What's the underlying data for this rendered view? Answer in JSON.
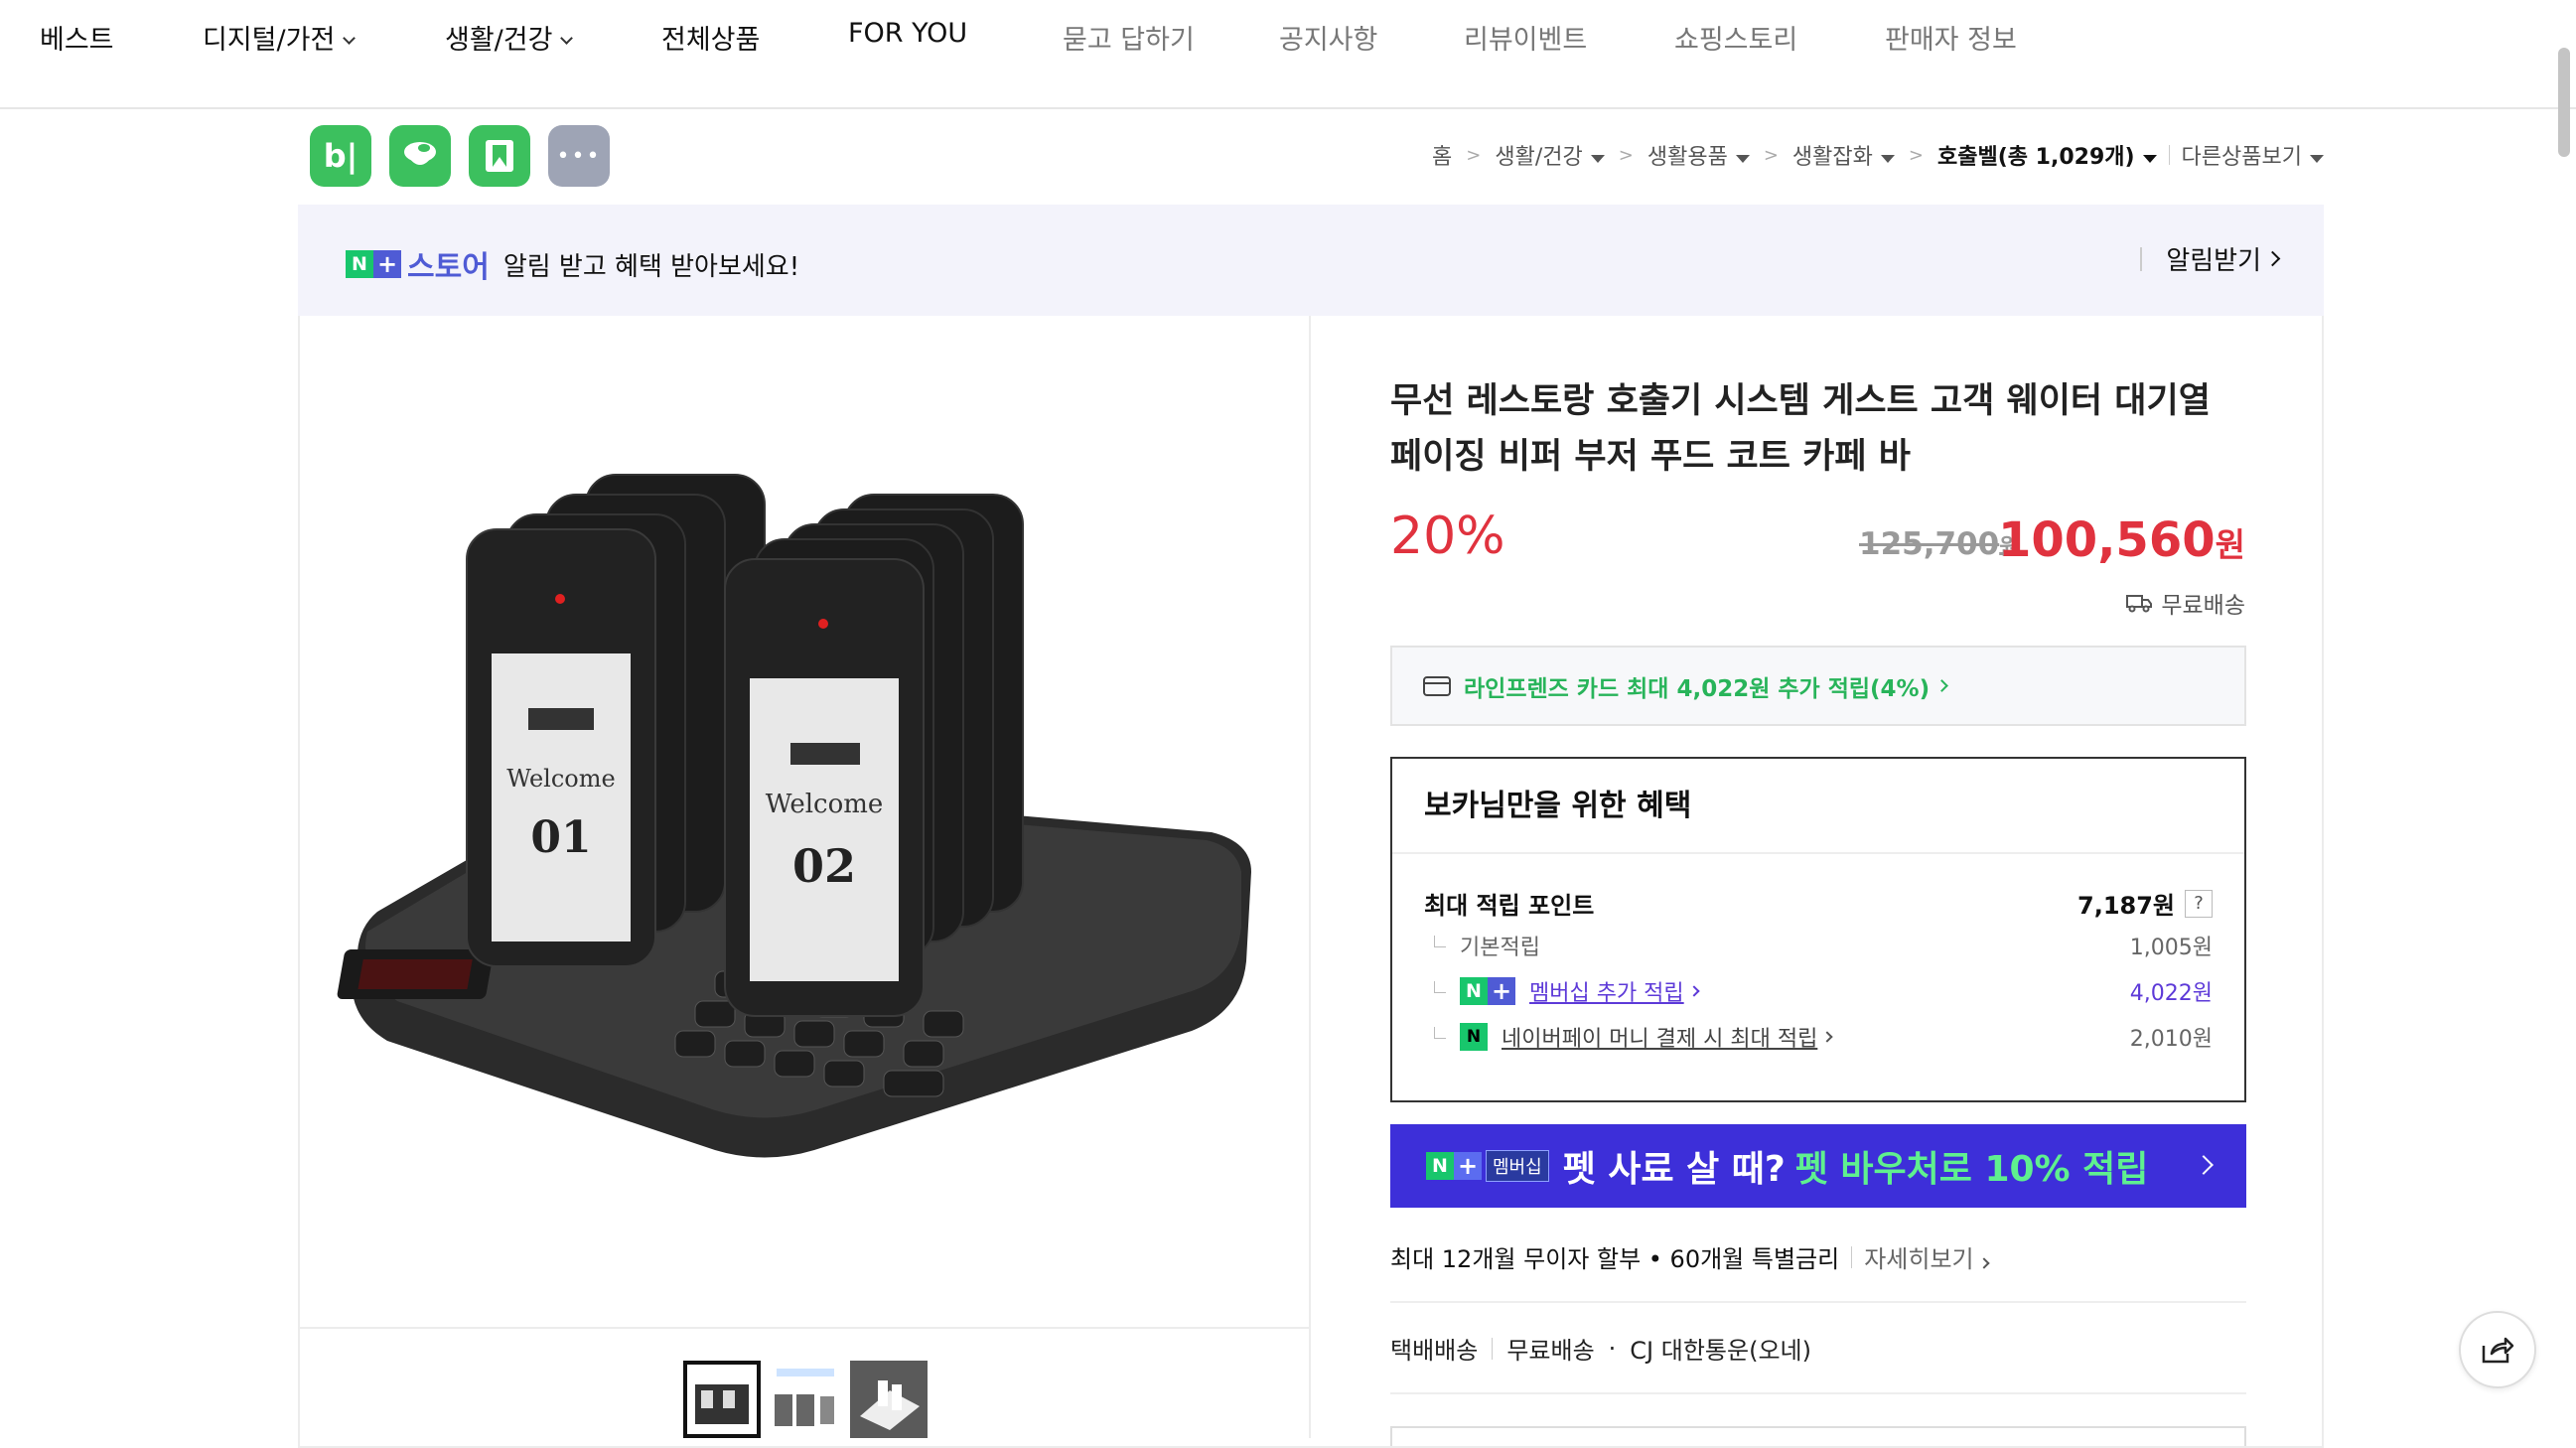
{
  "top_nav": {
    "items": [
      {
        "label": "베스트",
        "has_dropdown": false
      },
      {
        "label": "디지털/가전",
        "has_dropdown": true
      },
      {
        "label": "생활/건강",
        "has_dropdown": true
      },
      {
        "label": "전체상품",
        "has_dropdown": false
      },
      {
        "label": "FOR YOU",
        "has_dropdown": false
      },
      {
        "label": "묻고 답하기",
        "has_dropdown": false
      },
      {
        "label": "공지사항",
        "has_dropdown": false
      },
      {
        "label": "리뷰이벤트",
        "has_dropdown": false
      },
      {
        "label": "쇼핑스토리",
        "has_dropdown": false
      },
      {
        "label": "판매자 정보",
        "has_dropdown": false
      }
    ]
  },
  "store_icons": [
    {
      "icon": "blog-icon",
      "text": "b|"
    },
    {
      "icon": "cafe-icon"
    },
    {
      "icon": "bookmark-icon"
    },
    {
      "icon": "more-icon",
      "text": "•••"
    }
  ],
  "breadcrumb": {
    "items": [
      "홈",
      "생활/건강",
      "생활용품",
      "생활잡화",
      "호출벨(총 1,029개)"
    ],
    "other": "다른상품보기"
  },
  "alert_banner": {
    "store_label": "스토어",
    "text": "알림 받고 혜택 받아보세요!",
    "button": "알림받기"
  },
  "product": {
    "title": "무선 레스토랑 호출기 시스템 게스트 고객 웨이터 대기열 페이징 비퍼 부저 푸드 코트 카페 바",
    "discount": "20%",
    "original_price": "125,700",
    "original_unit": "원",
    "sale_price": "100,560",
    "sale_unit": "원",
    "shipping": "무료배송",
    "image_pager_texts": [
      "Welcome",
      "01",
      "02"
    ]
  },
  "card_offer": {
    "text": "라인프렌즈 카드 최대 4,022원 추가 적립(4%)"
  },
  "benefits": {
    "title": "보카님만을 위한 혜택",
    "max_points_label": "최대 적립 포인트",
    "max_points_value": "7,187원",
    "help": "?",
    "rows": [
      {
        "label": "기본적립",
        "value": "1,005원"
      },
      {
        "label": "멤버십 추가 적립",
        "value": "4,022원"
      },
      {
        "label": "네이버페이 머니 결제 시 최대 적립",
        "value": "2,010원"
      }
    ]
  },
  "promo": {
    "tag": "멤버십",
    "text_white": "펫 사료 살 때?",
    "text_green": "펫 바우처로 10% 적립"
  },
  "installment": {
    "text": "최대 12개월 무이자 할부 • 60개월 특별금리",
    "more": "자세히보기"
  },
  "delivery": {
    "label": "택배배송",
    "fee": "무료배송",
    "carrier": "CJ 대한통운(오네)"
  },
  "colors": {
    "sale_red": "#e0323e",
    "naver_green": "#18c66c",
    "promo_blue": "#3d2fd9",
    "link_purple": "#5d3ad8"
  }
}
